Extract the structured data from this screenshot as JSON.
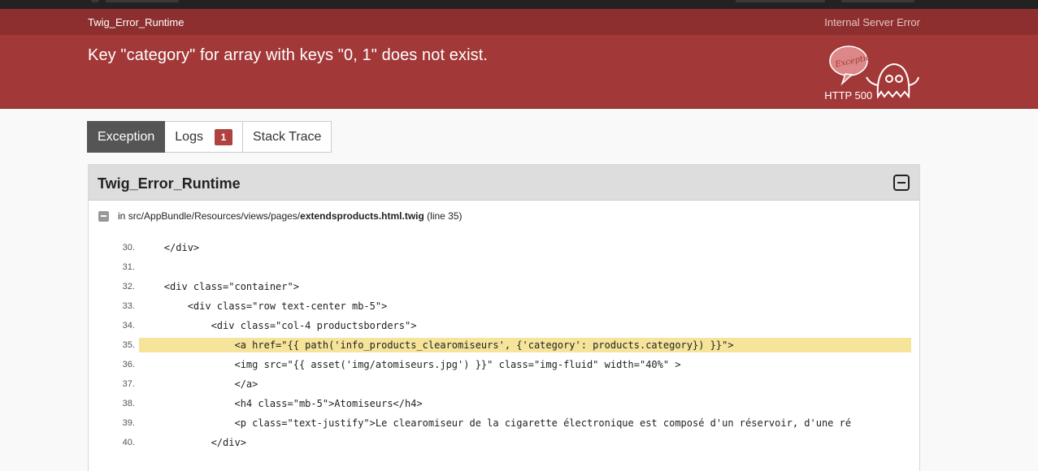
{
  "header": {
    "exception_class": "Twig_Error_Runtime",
    "http_code": "HTTP 500",
    "http_text": "Internal Server Error",
    "message": "Key \"category\" for array with keys \"0, 1\" does not exist.",
    "ghost_label": "Exception!"
  },
  "tabs": [
    {
      "label": "Exception",
      "active": true
    },
    {
      "label": "Logs",
      "badge": "1"
    },
    {
      "label": "Stack Trace"
    }
  ],
  "panel": {
    "title": "Twig_Error_Runtime",
    "trace": {
      "prefix": "in ",
      "path": "src/AppBundle/Resources/views/pages/",
      "file": "extendsproducts.html.twig",
      "line": " (line 35)"
    },
    "code_lines": [
      {
        "num": "30.",
        "text": "    </div>"
      },
      {
        "num": "31.",
        "text": ""
      },
      {
        "num": "32.",
        "text": "    <div class=\"container\">"
      },
      {
        "num": "33.",
        "text": "        <div class=\"row text-center mb-5\">"
      },
      {
        "num": "34.",
        "text": "            <div class=\"col-4 productsborders\">"
      },
      {
        "num": "35.",
        "text": "                <a href=\"{{ path('info_products_clearomiseurs', {'category': products.category}) }}\">",
        "highlight": true
      },
      {
        "num": "36.",
        "text": "                <img src=\"{{ asset('img/atomiseurs.jpg') }}\" class=\"img-fluid\" width=\"40%\" >"
      },
      {
        "num": "37.",
        "text": "                </a>"
      },
      {
        "num": "38.",
        "text": "                <h4 class=\"mb-5\">Atomiseurs</h4>"
      },
      {
        "num": "39.",
        "text": "                <p class=\"text-justify\">Le clearomiseur de la cigarette électronique est composé d'un réservoir, d'une ré"
      },
      {
        "num": "40.",
        "text": "            </div>"
      }
    ]
  },
  "colors": {
    "header_bg": "#a33838",
    "subheader_bg": "#8d2f2f",
    "highlight": "#f5e49a",
    "active_tab": "#555555",
    "badge": "#b0413e"
  }
}
